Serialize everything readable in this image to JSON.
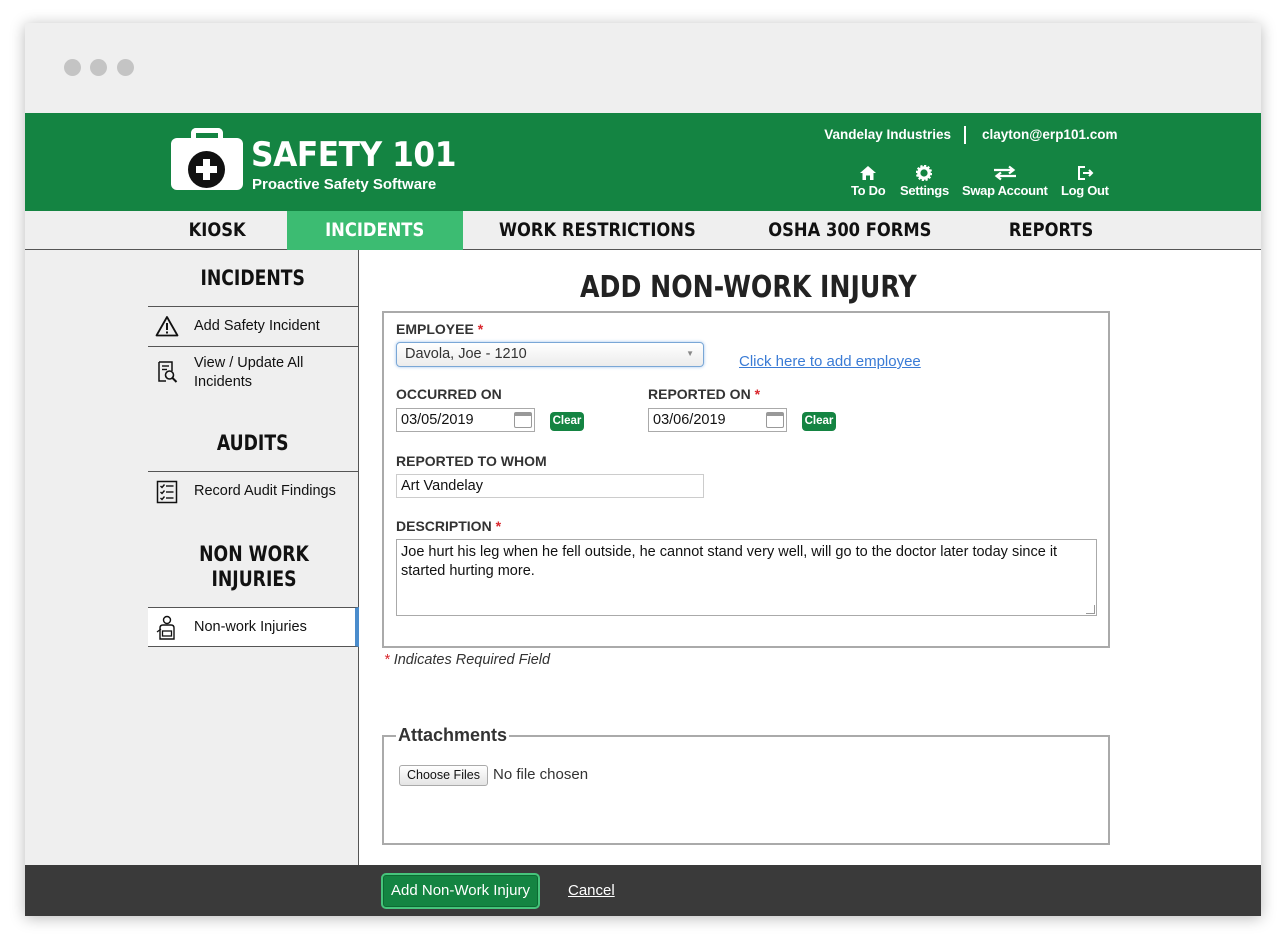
{
  "header": {
    "brand_name": "SAFETY 101",
    "brand_tagline": "Proactive Safety Software",
    "company": "Vandelay Industries",
    "user_email": "clayton@erp101.com",
    "links": [
      {
        "label": "To Do",
        "icon": "home-icon"
      },
      {
        "label": "Settings",
        "icon": "gear-icon"
      },
      {
        "label": "Swap Account",
        "icon": "swap-arrows-icon"
      },
      {
        "label": "Log Out",
        "icon": "logout-icon"
      }
    ]
  },
  "nav": {
    "tabs": [
      {
        "label": "KIOSK",
        "active": false
      },
      {
        "label": "INCIDENTS",
        "active": true
      },
      {
        "label": "WORK RESTRICTIONS",
        "active": false
      },
      {
        "label": "OSHA 300 FORMS",
        "active": false
      },
      {
        "label": "REPORTS",
        "active": false
      }
    ]
  },
  "sidebar": {
    "incidents_heading": "INCIDENTS",
    "incidents_items": [
      {
        "label": "Add Safety Incident",
        "icon": "warning-triangle-icon"
      },
      {
        "label": "View / Update All Incidents",
        "icon": "document-search-icon"
      }
    ],
    "audits_heading": "AUDITS",
    "audits_items": [
      {
        "label": "Record Audit Findings",
        "icon": "checklist-icon"
      }
    ],
    "nonwork_heading": "NON WORK INJURIES",
    "nonwork_items": [
      {
        "label": "Non-work Injuries",
        "icon": "injured-person-icon",
        "active": true
      }
    ]
  },
  "form": {
    "title": "ADD NON-WORK INJURY",
    "employee_label": "EMPLOYEE",
    "employee_value": "Davola, Joe - 1210",
    "add_employee_link": "Click here to add employee",
    "occurred_label": "OCCURRED ON",
    "occurred_value": "03/05/2019",
    "reported_label": "REPORTED ON",
    "reported_value": "03/06/2019",
    "clear_label": "Clear",
    "reported_to_label": "REPORTED TO WHOM",
    "reported_to_value": "Art Vandelay",
    "description_label": "DESCRIPTION",
    "description_value": "Joe hurt his leg when he fell outside, he cannot stand very well, will go to the doctor later today since it started hurting more.",
    "required_marker": "*",
    "required_note": "Indicates Required Field"
  },
  "attachments": {
    "legend": "Attachments",
    "choose_button": "Choose Files",
    "no_file_text": "No file chosen"
  },
  "footer": {
    "submit_label": "Add Non-Work Injury",
    "cancel_label": "Cancel"
  },
  "colors": {
    "brand_green": "#148442",
    "active_tab_green": "#3cbc72",
    "link_blue": "#3a7bd5",
    "required_red": "#d9262c",
    "footer_dark": "#3a3a3a"
  }
}
